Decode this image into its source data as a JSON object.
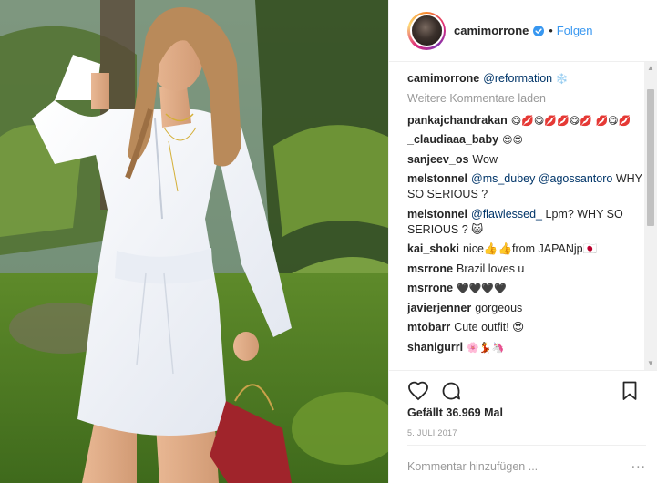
{
  "header": {
    "username": "camimorrone",
    "verified": true,
    "follow_label": "Folgen",
    "separator": "•"
  },
  "caption": {
    "username": "camimorrone",
    "mention": "@reformation",
    "emoji": "❄️"
  },
  "load_more_label": "Weitere Kommentare laden",
  "comments": [
    {
      "user": "pankajchandrakan",
      "text": "😋💋😋💋💋😋💋 💋😋💋"
    },
    {
      "user": "_claudiaaa_baby",
      "text": "😍😍"
    },
    {
      "user": "sanjeev_os",
      "text": "Wow"
    },
    {
      "user": "melstonnel",
      "mention": "@ms_dubey @agossantoro",
      "text": "WHY SO SERIOUS ?"
    },
    {
      "user": "melstonnel",
      "mention": "@flawlessed_",
      "text": "Lpm? WHY SO SERIOUS ? 😺"
    },
    {
      "user": "kai_shoki",
      "text": "nice👍👍from JAPANjp🇯🇵"
    },
    {
      "user": "msrrone",
      "text": "Brazil loves u"
    },
    {
      "user": "msrrone",
      "text": "🖤🖤🖤🖤"
    },
    {
      "user": "javierjenner",
      "text": "gorgeous"
    },
    {
      "user": "mtobarr",
      "text": "Cute outfit! 😍"
    },
    {
      "user": "shanigurrl",
      "text": "🌸💃🦄"
    }
  ],
  "likes_label": "Gefällt 36.969 Mal",
  "date_label": "5. JULI 2017",
  "comment_input": {
    "placeholder": "Kommentar hinzufügen ..."
  },
  "more_options_label": "...",
  "scrollbar": {
    "up_glyph": "▲",
    "down_glyph": "▼"
  },
  "icons": {
    "like": "heart-icon",
    "comment": "comment-bubble-icon",
    "save": "bookmark-icon",
    "verified": "verified-badge-icon"
  },
  "colors": {
    "accent": "#3897f0",
    "mention": "#003569",
    "muted": "#999999",
    "text": "#262626"
  }
}
